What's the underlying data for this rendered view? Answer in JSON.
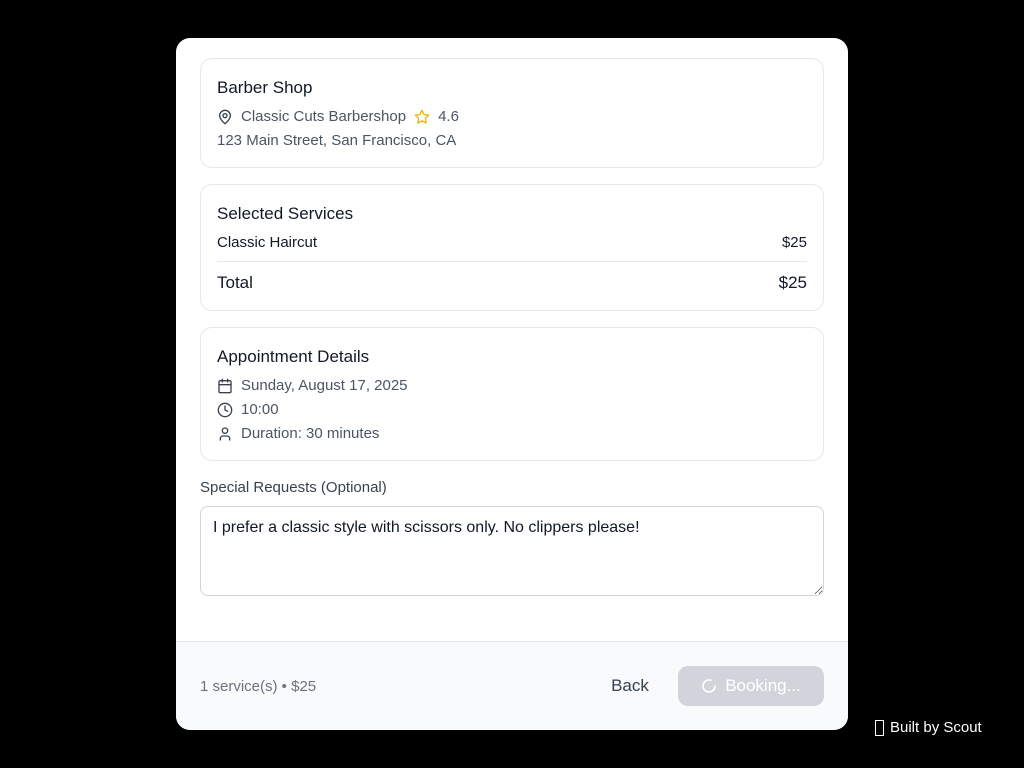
{
  "shop": {
    "title": "Barber Shop",
    "name": "Classic Cuts Barbershop",
    "rating": "4.6",
    "address": "123 Main Street, San Francisco, CA"
  },
  "services": {
    "title": "Selected Services",
    "items": [
      {
        "name": "Classic Haircut",
        "price": "$25"
      }
    ],
    "total_label": "Total",
    "total_value": "$25"
  },
  "appointment": {
    "title": "Appointment Details",
    "date": "Sunday, August 17, 2025",
    "time": "10:00",
    "duration": "Duration: 30 minutes"
  },
  "special_requests": {
    "label": "Special Requests (Optional)",
    "value": "I prefer a classic style with scissors only. No clippers please!"
  },
  "footer": {
    "summary": "1 service(s) • $25",
    "back_label": "Back",
    "book_label": "Booking..."
  },
  "branding": {
    "built_by": "Built by Scout"
  },
  "colors": {
    "star": "#eab308",
    "disabled_button": "#d1d5db"
  },
  "icons": {
    "location": "map-pin-icon",
    "rating": "star-icon",
    "date": "calendar-icon",
    "time": "clock-icon",
    "duration": "user-icon",
    "loading": "spinner-icon"
  }
}
